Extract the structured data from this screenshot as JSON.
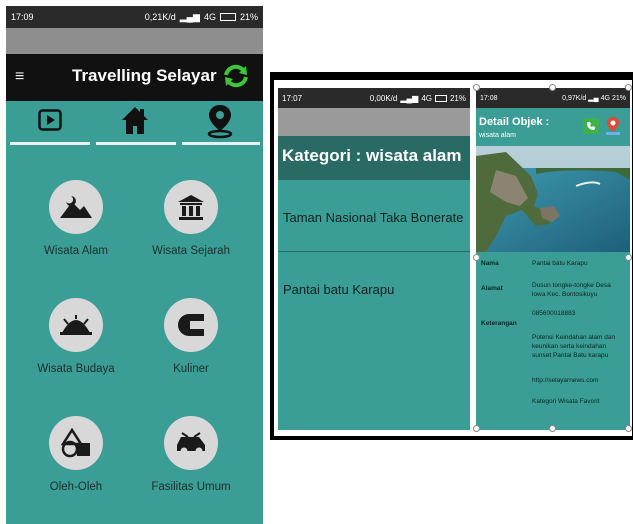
{
  "screen1": {
    "status": {
      "time": "17:09",
      "speed": "0,21K/d",
      "network": "4G",
      "battery": "21%"
    },
    "app_title": "Travelling Selayar",
    "menu_glyph": "≡",
    "tabs": [
      {
        "icon": "play-icon"
      },
      {
        "icon": "home-icon"
      },
      {
        "icon": "location-pin-icon"
      }
    ],
    "categories": [
      {
        "label": "Wisata Alam",
        "icon": "mountain-icon"
      },
      {
        "label": "Wisata Sejarah",
        "icon": "museum-icon"
      },
      {
        "label": "Wisata Budaya",
        "icon": "culture-icon"
      },
      {
        "label": "Kuliner",
        "icon": "food-icon"
      },
      {
        "label": "Oleh-Oleh",
        "icon": "shapes-icon"
      },
      {
        "label": "Fasilitas Umum",
        "icon": "car-icon"
      }
    ],
    "colors": {
      "background": "#3a9e96",
      "toolbar": "#111111",
      "refresh": "#3cc63a"
    }
  },
  "screen2": {
    "status": {
      "time": "17:07",
      "speed": "0,00K/d",
      "network": "4G",
      "battery": "21%"
    },
    "heading": "Kategori  : wisata alam",
    "items": [
      "Taman Nasional Taka Bonerate",
      "Pantai batu Karapu"
    ]
  },
  "screen3": {
    "status": {
      "time": "17:08",
      "speed": "0,97K/d",
      "network": "4G",
      "battery": "21%"
    },
    "title": "Detail Objek  :",
    "subtitle": "wisata alam",
    "fields": {
      "nama_label": "Nama",
      "nama": "Pantai batu Karapu",
      "alamat_label": "Alamat",
      "alamat": "Dusun tongke-tongke Desa lowa Kec. Bontosikuyu",
      "phone": "085600018883",
      "keterangan_label": "Keterangan",
      "keterangan": "Potensi Keindahan alam dan keunikan serta keindahan sunset Pantai Batu karapu",
      "website": "http://selayarnews.com",
      "kategori": "Kategori Wisata Favorit"
    }
  }
}
